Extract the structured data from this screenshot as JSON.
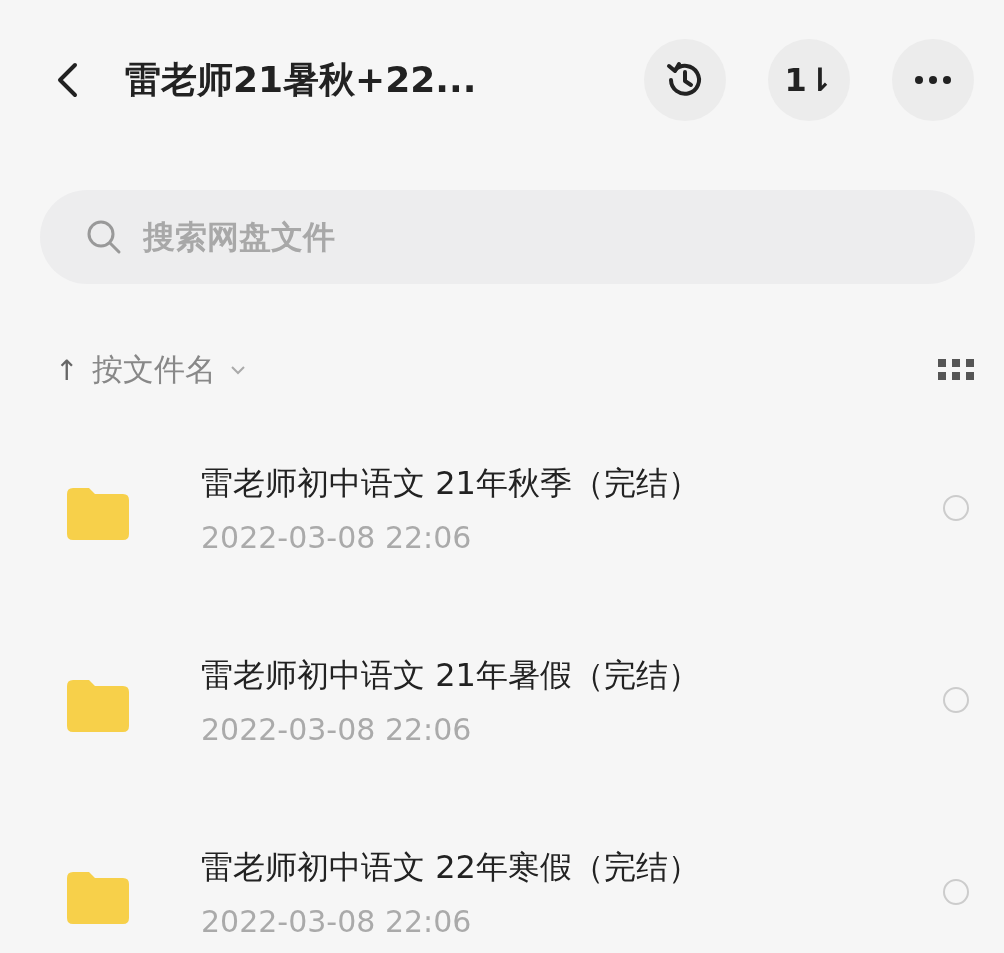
{
  "header": {
    "title": "雷老师21暑秋+22...",
    "sort_button": {
      "label": "1⇂"
    }
  },
  "search": {
    "placeholder": "搜索网盘文件"
  },
  "sort_bar": {
    "arrow": "↑",
    "label": "按文件名"
  },
  "files": [
    {
      "name": "雷老师初中语文 21年秋季（完结）",
      "date": "2022-03-08  22:06",
      "selected": false
    },
    {
      "name": "雷老师初中语文 21年暑假（完结）",
      "date": "2022-03-08  22:06",
      "selected": false
    },
    {
      "name": "雷老师初中语文 22年寒假（完结）",
      "date": "2022-03-08  22:06",
      "selected": false
    }
  ]
}
